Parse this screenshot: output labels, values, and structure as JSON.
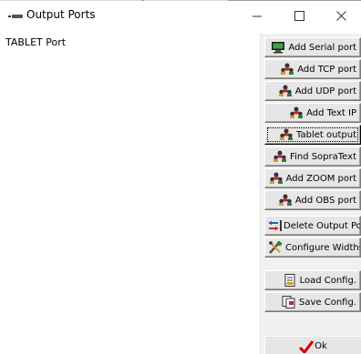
{
  "window": {
    "title": "Output Ports",
    "minimize_glyph": "—",
    "maximize_glyph": "☐",
    "close_glyph": "✕",
    "app_icon": "output-ports-app-icon"
  },
  "list": {
    "items": [
      "TABLET Port"
    ]
  },
  "buttons": {
    "add_serial": {
      "label": "Add Serial port",
      "icon": "monitor-icon"
    },
    "add_tcp": {
      "label": "Add TCP port",
      "icon": "network-people-icon"
    },
    "add_udp": {
      "label": "Add UDP port",
      "icon": "network-people-icon"
    },
    "add_text_ip": {
      "label": "Add Text IP",
      "icon": "network-people-icon"
    },
    "tablet_output": {
      "label": "Tablet output",
      "icon": "network-people-icon"
    },
    "find_sopratext": {
      "label": "Find SopraText",
      "icon": "network-people-icon"
    },
    "add_zoom": {
      "label": "Add ZOOM port",
      "icon": "network-people-icon"
    },
    "add_obs": {
      "label": "Add OBS port",
      "icon": "network-people-icon"
    },
    "delete_output": {
      "label": "Delete Output Por",
      "icon": "delete-arrows-icon"
    },
    "configure_widths": {
      "label": "Configure Widths",
      "icon": "tools-icon"
    },
    "load_config": {
      "label": "Load Config.",
      "icon": "load-document-icon"
    },
    "save_config": {
      "label": "Save Config.",
      "icon": "save-document-icon"
    },
    "ok": {
      "label": "Ok",
      "icon": "checkmark-icon"
    }
  },
  "colors": {
    "panel_bg": "#f0f0f0",
    "button_face": "#e6e6e6",
    "checkmark": "#d40000"
  }
}
